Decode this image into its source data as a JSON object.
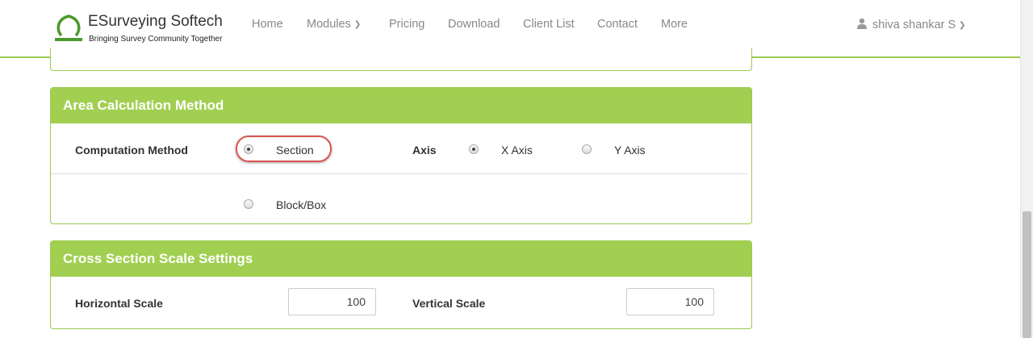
{
  "brand": {
    "title": "ESurveying Softech",
    "tagline": "Bringing Survey Community Together"
  },
  "nav": {
    "items": [
      {
        "label": "Home"
      },
      {
        "label": "Modules"
      },
      {
        "label": "Pricing"
      },
      {
        "label": "Download"
      },
      {
        "label": "Client List"
      },
      {
        "label": "Contact"
      },
      {
        "label": "More"
      }
    ],
    "user": "shiva shankar S"
  },
  "area_panel": {
    "title": "Area Calculation Method",
    "computation_label": "Computation Method",
    "option_section": "Section",
    "option_blockbox": "Block/Box",
    "axis_label": "Axis",
    "option_x_axis": "X Axis",
    "option_y_axis": "Y Axis",
    "selected_method": "Section",
    "selected_axis": "X Axis"
  },
  "scale_panel": {
    "title": "Cross Section Scale Settings",
    "horizontal_label": "Horizontal Scale",
    "horizontal_value": "100",
    "vertical_label": "Vertical Scale",
    "vertical_value": "100"
  },
  "colors": {
    "accent_green": "#a1cf51",
    "highlight_red": "#d9534f"
  }
}
